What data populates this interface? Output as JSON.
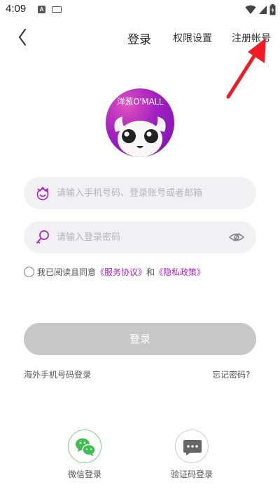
{
  "status_bar": {
    "time": "4:09"
  },
  "nav": {
    "title": "登录",
    "permissions_label": "权限设置",
    "register_label": "注册帐号"
  },
  "logo": {
    "text": "洋葱O'MALL"
  },
  "form": {
    "account_placeholder": "请输入手机号码、登录账号或者邮箱",
    "password_placeholder": "请输入登录密码",
    "agreement_prefix": "我已阅读且同意",
    "service_agreement": "《服务协议》",
    "agreement_and": "和",
    "privacy_policy": "《隐私政策》",
    "login_button": "登录",
    "overseas_login": "海外手机号码登录",
    "forgot_password": "忘记密码?"
  },
  "other_login": {
    "wechat_label": "微信登录",
    "sms_label": "验证码登录"
  },
  "colors": {
    "accent": "#b01fc6",
    "button_disabled": "#c7c7c7",
    "wechat_green": "#3fbf4f",
    "annotation_red": "#ee1c24"
  }
}
